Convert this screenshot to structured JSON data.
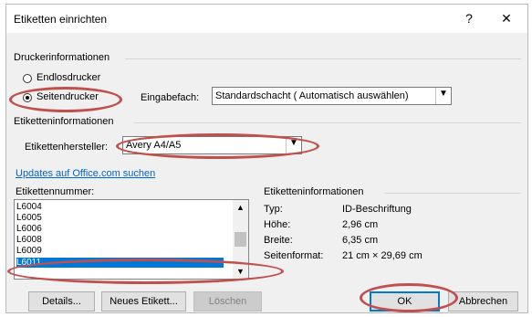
{
  "window": {
    "title": "Etiketten einrichten",
    "help_glyph": "?",
    "close_glyph": "✕"
  },
  "printer_info": {
    "heading": "Druckerinformationen",
    "radio_continuous": {
      "label": "Endlosdrucker",
      "checked": false
    },
    "radio_page": {
      "label": "Seitendrucker",
      "checked": true
    },
    "tray_label": "Eingabefach:",
    "tray_value": "Standardschacht ( Automatisch auswählen)"
  },
  "label_info": {
    "heading": "Etiketteninformationen",
    "vendor_label": "Etikettenhersteller:",
    "vendor_value": "Avery A4/A5",
    "update_link": "Updates auf Office.com suchen"
  },
  "label_number": {
    "heading": "Etikettennummer:",
    "items": [
      "L6004",
      "L6005",
      "L6006",
      "L6008",
      "L6009",
      "L6011"
    ],
    "selected": "L6011"
  },
  "details": {
    "heading": "Etiketteninformationen",
    "rows": [
      {
        "label": "Typ:",
        "value": "ID-Beschriftung"
      },
      {
        "label": "Höhe:",
        "value": "2,96 cm"
      },
      {
        "label": "Breite:",
        "value": "6,35 cm"
      },
      {
        "label": "Seitenformat:",
        "value": "21 cm × 29,69 cm"
      }
    ]
  },
  "buttons": {
    "details": "Details...",
    "new_label": "Neues Etikett...",
    "delete": "Löschen",
    "ok": "OK",
    "cancel": "Abbrechen"
  },
  "annotation_color": "#c0504d"
}
